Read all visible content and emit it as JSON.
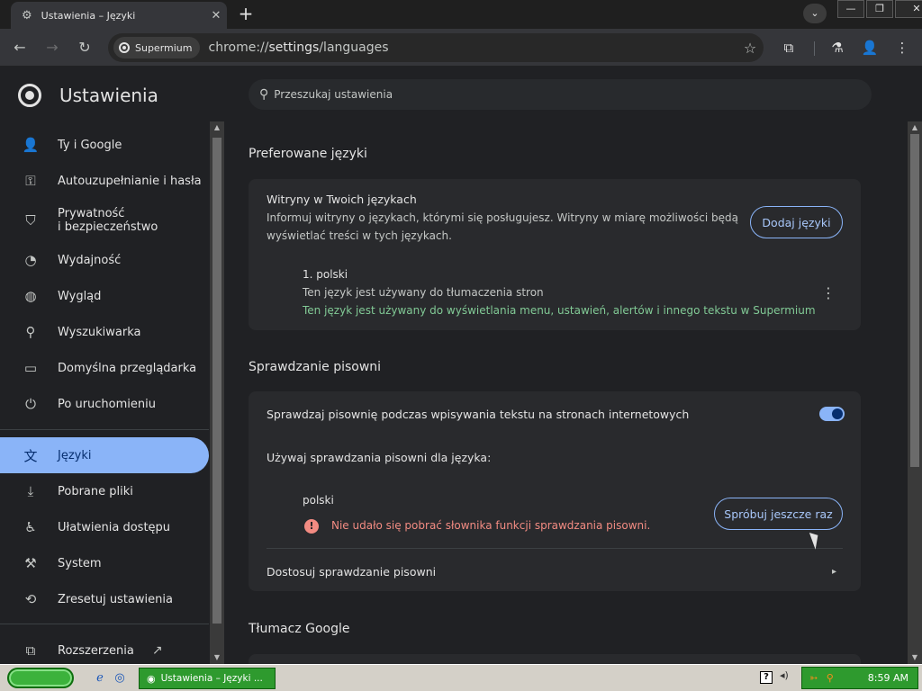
{
  "browser": {
    "tab": {
      "title": "Ustawienia – Języki",
      "icon": "gear-icon",
      "close_glyph": "✕"
    },
    "new_tab_glyph": "+",
    "tab_search_glyph": "⌄",
    "window_controls": {
      "minimize": "—",
      "restore": "❐",
      "close": "✕"
    },
    "toolbar": {
      "back_glyph": "←",
      "forward_glyph": "→",
      "reload_glyph": "↻",
      "chip_label": "Supermium",
      "url_scheme": "chrome://",
      "url_host": "settings",
      "url_path": "/languages",
      "star_glyph": "☆",
      "extensions_glyph": "⧉",
      "labs_glyph": "⚗",
      "profile_glyph": "👤",
      "menu_glyph": "⋮"
    }
  },
  "settings": {
    "app_title": "Ustawienia",
    "search_placeholder": "Przeszukaj ustawienia",
    "sidebar": {
      "items": [
        {
          "label": "Ty i Google",
          "icon": "person-icon",
          "glyph": "👤",
          "active": false
        },
        {
          "label": "Autouzupełnianie i hasła",
          "icon": "key-icon",
          "glyph": "⚿",
          "active": false
        },
        {
          "label": "Prywatność\ni bezpieczeństwo",
          "line1": "Prywatność",
          "line2": "i bezpieczeństwo",
          "icon": "shield-icon",
          "glyph": "⛉",
          "active": false
        },
        {
          "label": "Wydajność",
          "icon": "speedometer-icon",
          "glyph": "◔",
          "active": false
        },
        {
          "label": "Wygląd",
          "icon": "palette-icon",
          "glyph": "◍",
          "active": false
        },
        {
          "label": "Wyszukiwarka",
          "icon": "search-icon",
          "glyph": "⚲",
          "active": false
        },
        {
          "label": "Domyślna przeglądarka",
          "icon": "browser-window-icon",
          "glyph": "▭",
          "active": false
        },
        {
          "label": "Po uruchomieniu",
          "icon": "power-icon",
          "glyph": "⏻",
          "active": false
        },
        {
          "label": "Języki",
          "icon": "translate-icon",
          "glyph": "文",
          "active": true
        },
        {
          "label": "Pobrane pliki",
          "icon": "download-icon",
          "glyph": "⤓",
          "active": false
        },
        {
          "label": "Ułatwienia dostępu",
          "icon": "accessibility-icon",
          "glyph": "♿",
          "active": false
        },
        {
          "label": "System",
          "icon": "wrench-icon",
          "glyph": "⚒",
          "active": false
        },
        {
          "label": "Zresetuj ustawienia",
          "icon": "reset-icon",
          "glyph": "⟲",
          "active": false
        },
        {
          "label": "Rozszerzenia",
          "icon": "puzzle-icon",
          "glyph": "⧉",
          "active": false
        }
      ],
      "external_link_glyph": "↗"
    },
    "preferred_languages": {
      "section_title": "Preferowane języki",
      "card_title": "Witryny w Twoich językach",
      "card_desc_line1": "Informuj witryny o językach, którymi się posługujesz. Witryny w miarę możliwości będą",
      "card_desc_line2": "wyświetlać treści w tych językach.",
      "add_button": "Dodaj języki",
      "language_entry": {
        "name": "1. polski",
        "note_translate": "Ten język jest używany do tłumaczenia stron",
        "note_ui": "Ten język jest używany do wyświetlania menu, ustawień, alertów i innego tekstu w Supermium",
        "more_glyph": "⋮"
      }
    },
    "spellcheck": {
      "section_title": "Sprawdzanie pisowni",
      "toggle_label": "Sprawdzaj pisownię podczas wpisywania tekstu na stronach internetowych",
      "toggle_on": true,
      "use_for_label": "Używaj sprawdzania pisowni dla języka:",
      "language": "polski",
      "error_glyph": "!",
      "error_text": "Nie udało się pobrać słownika funkcji sprawdzania pisowni.",
      "retry_button": "Spróbuj jeszcze raz",
      "customize_label": "Dostosuj sprawdzanie pisowni",
      "chevron_glyph": "▸"
    },
    "translate": {
      "section_title": "Tłumacz Google"
    }
  },
  "taskbar": {
    "task_label": "Ustawienia – Języki ...",
    "task_icon": "chrome-icon",
    "quick_launch": [
      {
        "name": "ie-icon",
        "glyph": "ℯ"
      },
      {
        "name": "browser-quicklaunch-icon",
        "glyph": "◎"
      }
    ],
    "help_glyph": "?",
    "speaker_glyph": "◂)",
    "tray_icons_glyph": "➳ ⚲",
    "clock": "8:59 AM"
  },
  "colors": {
    "accent": "#8ab4f8",
    "success_text": "#81c995",
    "error_text": "#f28b82",
    "background": "#202124",
    "card": "#292a2d"
  }
}
